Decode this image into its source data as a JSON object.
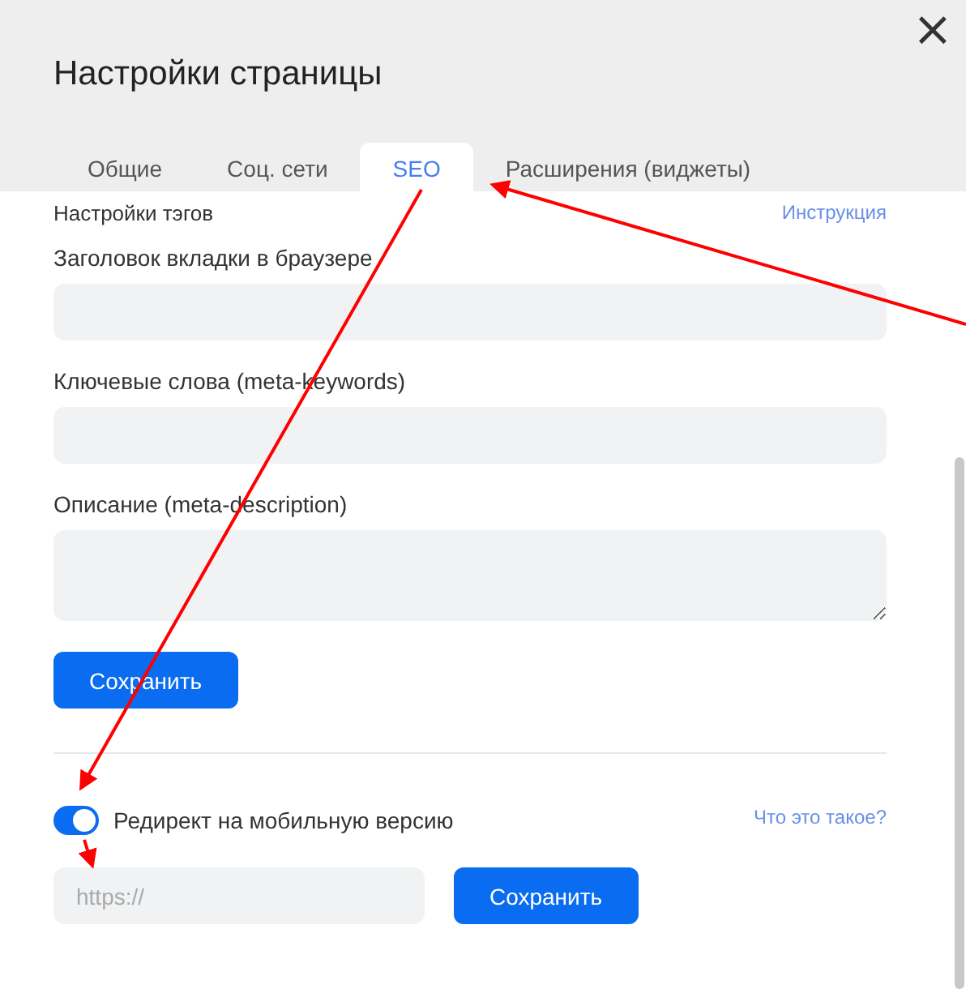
{
  "dialog": {
    "title": "Настройки страницы",
    "close": "×"
  },
  "tabs": [
    {
      "label": "Общие",
      "selected": false
    },
    {
      "label": "Соц. сети",
      "selected": false
    },
    {
      "label": "SEO",
      "selected": true
    },
    {
      "label": "Расширения (виджеты)",
      "selected": false
    }
  ],
  "section": {
    "title": "Настройки тэгов",
    "link": "Инструкция"
  },
  "fields": [
    {
      "label": "Заголовок вкладки в браузере",
      "kind": "input"
    },
    {
      "label": "Ключевые слова (meta-keywords)",
      "kind": "input"
    },
    {
      "label": "Описание (meta-description)",
      "kind": "textarea"
    }
  ],
  "save_button": "Сохранить",
  "redirect": {
    "label": "Редирект на мобильную версию",
    "on": true,
    "help_link": "Что это такое?",
    "placeholder": "https://",
    "save_button": "Сохранить"
  }
}
